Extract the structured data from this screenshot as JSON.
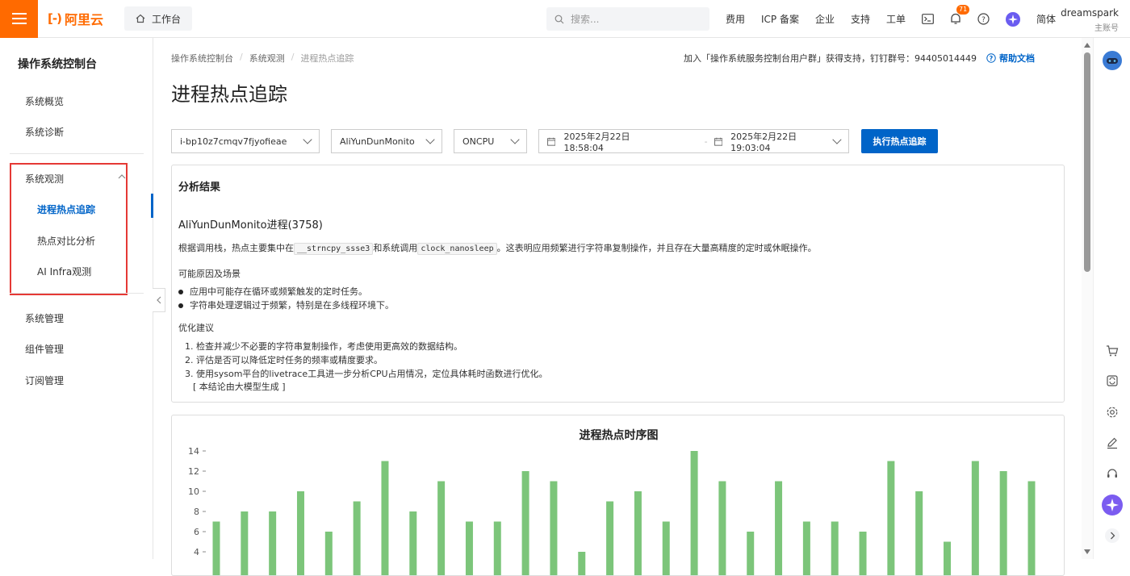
{
  "topbar": {
    "logo_text": "阿里云",
    "workbench_label": "工作台",
    "search_placeholder": "搜索...",
    "nav": [
      "费用",
      "ICP 备案",
      "企业",
      "支持",
      "工单"
    ],
    "notification_count": "71",
    "language": "简体",
    "user_name": "dreamspark",
    "user_role": "主账号",
    "accent_color": "#ff6a00"
  },
  "sidebar": {
    "title": "操作系统控制台",
    "items_top": [
      "系统概览",
      "系统诊断"
    ],
    "group_label": "系统观测",
    "group_items": [
      "进程热点追踪",
      "热点对比分析",
      "AI Infra观测"
    ],
    "items_bottom": [
      "系统管理",
      "组件管理",
      "订阅管理"
    ]
  },
  "main": {
    "breadcrumb": [
      "操作系统控制台",
      "系统观测",
      "进程热点追踪"
    ],
    "join_text": "加入「操作系统服务控制台用户群」获得支持，钉钉群号：94405014449",
    "help_label": "帮助文档",
    "page_title": "进程热点追踪",
    "filters": {
      "instance": "i-bp10z7cmqv7fjyofieae",
      "process": "AliYunDunMonito",
      "type": "ONCPU",
      "start_time": "2025年2月22日 18:58:04",
      "end_time": "2025年2月22日 19:03:04",
      "run_label": "执行热点追踪"
    },
    "result": {
      "heading": "分析结果",
      "process": "AliYunDunMonito进程(3758)",
      "desc_pre": "根据调用栈，热点主要集中在",
      "func1": "__strncpy_ssse3",
      "desc_mid": "和系统调用",
      "func2": "clock_nanosleep",
      "desc_post": "。这表明应用频繁进行字符串复制操作，并且存在大量高精度的定时或休眠操作。",
      "causes_title": "可能原因及场景",
      "causes": [
        "应用中可能存在循环或频繁触发的定时任务。",
        "字符串处理逻辑过于频繁，特别是在多线程环境下。"
      ],
      "advice_title": "优化建议",
      "advice": [
        "1. 检查并减少不必要的字符串复制操作，考虑使用更高效的数据结构。",
        "2. 评估是否可以降低定时任务的频率或精度要求。",
        "3. 使用sysom平台的livetrace工具进一步分析CPU占用情况，定位具体耗时函数进行优化。"
      ],
      "note": "[ 本结论由大模型生成 ]"
    }
  },
  "chart_data": {
    "type": "bar",
    "title": "进程热点时序图",
    "values": [
      7,
      8,
      8,
      10,
      6,
      9,
      13,
      8,
      11,
      7,
      7,
      12,
      11,
      4,
      9,
      10,
      7,
      14,
      11,
      6,
      11,
      7,
      7,
      6,
      13,
      10,
      5,
      13,
      12,
      11
    ],
    "yticks": [
      4,
      6,
      8,
      10,
      12,
      14
    ],
    "ylim": [
      0,
      15
    ],
    "color": "#7cc57a"
  }
}
